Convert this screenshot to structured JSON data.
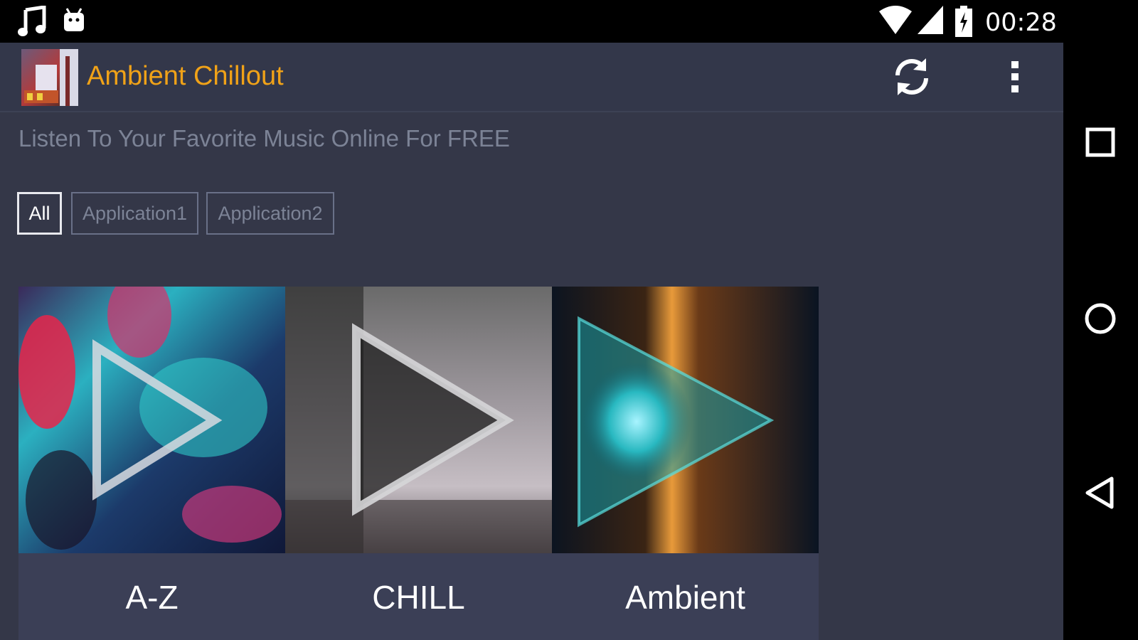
{
  "status_bar": {
    "time": "00:28",
    "left_icons": [
      "music-note-icon",
      "android-icon"
    ],
    "right_icons": [
      "wifi-icon",
      "cell-signal-icon",
      "battery-charging-icon"
    ]
  },
  "app_bar": {
    "title": "Ambient Chillout",
    "title_color": "#f0a218",
    "actions": [
      "refresh-icon",
      "more-vert-icon"
    ]
  },
  "tagline": "Listen To Your Favorite Music Online For FREE",
  "filters": [
    {
      "label": "All",
      "selected": true
    },
    {
      "label": "Application1",
      "selected": false
    },
    {
      "label": "Application2",
      "selected": false
    }
  ],
  "cards": [
    {
      "label": "A-Z"
    },
    {
      "label": "CHILL"
    },
    {
      "label": "Ambient"
    }
  ],
  "nav_bar": [
    "recents-square-icon",
    "home-circle-icon",
    "back-triangle-icon"
  ],
  "colors": {
    "background": "#343748",
    "card_panel": "#3b3f56",
    "muted_text": "#7c8396",
    "chip_border": "#697088"
  }
}
